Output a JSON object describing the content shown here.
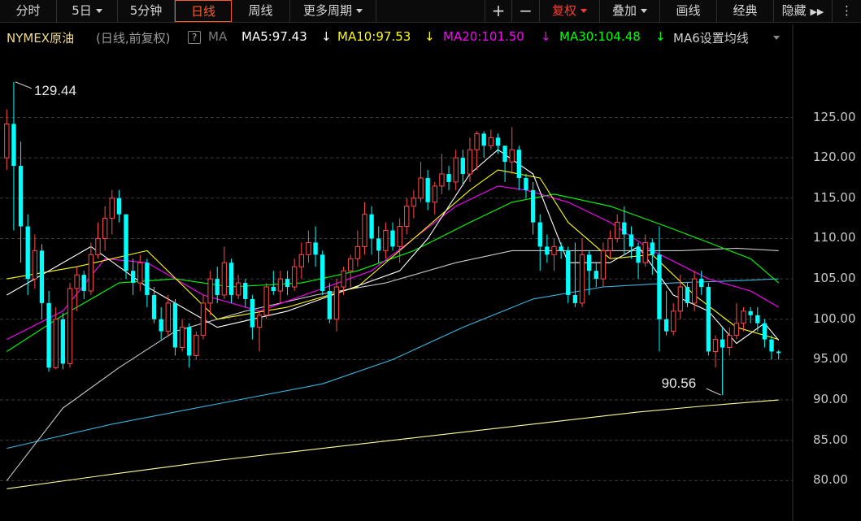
{
  "toolbar": {
    "tabs": [
      {
        "label": "分时"
      },
      {
        "label": "5日",
        "dropdown": true
      },
      {
        "label": "5分钟"
      },
      {
        "label": "日线",
        "active": true
      },
      {
        "label": "周线"
      },
      {
        "label": "更多周期",
        "dropdown": true
      }
    ],
    "right": [
      {
        "label": "+"
      },
      {
        "label": "−"
      },
      {
        "label": "复权",
        "dropdown": true,
        "accent": true
      },
      {
        "label": "叠加",
        "dropdown": true
      },
      {
        "label": "画线"
      },
      {
        "label": "经典"
      },
      {
        "label": "隐藏"
      }
    ],
    "expand_icon": "double-chevron-right-icon"
  },
  "legend": {
    "symbol": "NYMEX原油",
    "mode": "(日线,前复权)",
    "help": "?",
    "ma_label": "MA",
    "ma5": "MA5:97.43",
    "ma10": "MA10:97.53",
    "ma20": "MA20:101.50",
    "ma30": "MA30:104.48",
    "ma6": "MA6设置均线",
    "colors": {
      "ma5": "#ffffff",
      "ma10": "#ffff00",
      "ma20": "#ff00ff",
      "ma30": "#00ff00"
    }
  },
  "annotations": {
    "high": "129.44",
    "low": "90.56"
  },
  "colors": {
    "up": "#ff4a4a",
    "down": "#00ffff",
    "ma5": "#ffffff",
    "ma10": "#ffff00",
    "ma20": "#ff00ff",
    "ma30": "#00ff00",
    "ma60": "#c8c8c8",
    "ma120": "#3ab4e0",
    "ma250": "#ffff99",
    "grid": "#3a3a3a"
  },
  "chart_data": {
    "type": "candlestick",
    "ylim": [
      75,
      132
    ],
    "yticks": [
      "125.00",
      "120.00",
      "115.00",
      "110.00",
      "105.00",
      "100.00",
      "95.00",
      "90.00",
      "85.00",
      "80.00"
    ],
    "grid": true,
    "candles": [
      [
        120.0,
        124.2,
        126.0,
        118.5
      ],
      [
        124.2,
        119.0,
        129.4,
        111.0
      ],
      [
        119.0,
        111.5,
        122.0,
        107.0
      ],
      [
        111.5,
        105.0,
        113.0,
        103.0
      ],
      [
        105.0,
        108.5,
        110.5,
        103.8
      ],
      [
        108.5,
        102.0,
        109.3,
        100.0
      ],
      [
        102.0,
        94.0,
        103.5,
        93.5
      ],
      [
        94.0,
        100.0,
        101.5,
        93.8
      ],
      [
        100.0,
        94.5,
        100.8,
        93.8
      ],
      [
        94.5,
        103.8,
        104.5,
        94.0
      ],
      [
        103.8,
        105.5,
        106.5,
        101.0
      ],
      [
        105.5,
        103.5,
        106.0,
        102.5
      ],
      [
        103.5,
        108.0,
        109.5,
        103.0
      ],
      [
        108.0,
        110.0,
        112.0,
        107.5
      ],
      [
        110.0,
        112.5,
        114.0,
        108.5
      ],
      [
        112.5,
        115.0,
        116.0,
        110.5
      ],
      [
        115.0,
        113.0,
        116.0,
        112.0
      ],
      [
        113.0,
        106.0,
        113.0,
        105.0
      ],
      [
        106.0,
        104.5,
        107.5,
        103.0
      ],
      [
        104.5,
        107.0,
        108.0,
        103.5
      ],
      [
        107.0,
        103.0,
        107.5,
        101.5
      ],
      [
        103.0,
        100.0,
        104.0,
        99.5
      ],
      [
        100.0,
        98.5,
        101.5,
        97.5
      ],
      [
        98.5,
        102.0,
        103.0,
        98.0
      ],
      [
        102.0,
        96.5,
        102.5,
        95.5
      ],
      [
        96.5,
        99.0,
        100.0,
        96.0
      ],
      [
        99.0,
        95.5,
        99.5,
        94.0
      ],
      [
        95.5,
        98.0,
        98.5,
        95.0
      ],
      [
        98.0,
        102.0,
        103.0,
        97.5
      ],
      [
        102.0,
        105.0,
        106.0,
        100.5
      ],
      [
        105.0,
        103.0,
        106.5,
        102.0
      ],
      [
        103.0,
        107.0,
        109.0,
        102.5
      ],
      [
        107.0,
        103.0,
        107.5,
        102.0
      ],
      [
        103.0,
        104.5,
        105.5,
        102.5
      ],
      [
        104.5,
        102.5,
        105.0,
        101.5
      ],
      [
        102.5,
        99.0,
        103.0,
        97.5
      ],
      [
        99.0,
        100.5,
        101.0,
        96.0
      ],
      [
        100.5,
        104.0,
        104.5,
        100.0
      ],
      [
        104.0,
        103.5,
        106.0,
        103.0
      ],
      [
        103.5,
        105.0,
        106.0,
        102.0
      ],
      [
        105.0,
        104.0,
        106.0,
        103.0
      ],
      [
        104.0,
        106.5,
        107.5,
        103.5
      ],
      [
        106.5,
        108.0,
        109.5,
        105.0
      ],
      [
        108.0,
        109.5,
        111.0,
        107.0
      ],
      [
        109.5,
        108.0,
        111.5,
        106.5
      ],
      [
        108.0,
        103.5,
        108.5,
        103.0
      ],
      [
        103.5,
        100.0,
        104.5,
        99.5
      ],
      [
        100.0,
        104.0,
        105.0,
        98.5
      ],
      [
        104.0,
        106.0,
        106.5,
        103.0
      ],
      [
        106.0,
        107.5,
        108.0,
        104.0
      ],
      [
        107.5,
        109.0,
        111.0,
        106.5
      ],
      [
        109.0,
        113.0,
        114.5,
        108.0
      ],
      [
        113.0,
        110.0,
        114.0,
        108.0
      ],
      [
        110.0,
        108.5,
        111.5,
        107.0
      ],
      [
        108.5,
        111.0,
        112.0,
        107.5
      ],
      [
        111.0,
        109.0,
        112.0,
        108.5
      ],
      [
        109.0,
        111.5,
        112.5,
        107.0
      ],
      [
        111.5,
        114.0,
        115.0,
        110.5
      ],
      [
        114.0,
        115.0,
        116.0,
        112.5
      ],
      [
        115.0,
        117.5,
        119.5,
        114.5
      ],
      [
        117.5,
        114.5,
        118.5,
        113.5
      ],
      [
        114.5,
        116.5,
        117.0,
        113.0
      ],
      [
        116.5,
        118.0,
        120.5,
        115.5
      ],
      [
        118.0,
        117.0,
        119.0,
        116.0
      ],
      [
        117.0,
        120.0,
        121.0,
        116.0
      ],
      [
        120.0,
        118.0,
        121.0,
        116.5
      ],
      [
        118.0,
        121.0,
        122.5,
        117.0
      ],
      [
        121.0,
        123.0,
        123.3,
        118.5
      ],
      [
        123.0,
        121.5,
        123.3,
        120.0
      ],
      [
        121.5,
        122.5,
        123.5,
        121.0
      ],
      [
        122.5,
        121.5,
        123.0,
        120.5
      ],
      [
        121.5,
        119.5,
        121.5,
        117.0
      ],
      [
        119.5,
        121.0,
        123.8,
        118.0
      ],
      [
        121.0,
        117.5,
        121.5,
        116.0
      ],
      [
        117.5,
        116.0,
        118.0,
        115.0
      ],
      [
        116.0,
        112.0,
        117.0,
        110.5
      ],
      [
        112.0,
        109.0,
        113.0,
        106.0
      ],
      [
        109.0,
        108.0,
        110.5,
        107.0
      ],
      [
        108.0,
        109.0,
        110.0,
        106.0
      ],
      [
        109.0,
        108.5,
        109.5,
        107.5
      ],
      [
        108.5,
        103.0,
        109.0,
        102.0
      ],
      [
        103.0,
        102.0,
        109.5,
        101.5
      ],
      [
        102.0,
        108.0,
        110.0,
        101.5
      ],
      [
        108.0,
        106.0,
        108.5,
        103.0
      ],
      [
        106.0,
        105.0,
        107.0,
        104.0
      ],
      [
        105.0,
        108.5,
        109.5,
        104.0
      ],
      [
        108.5,
        110.0,
        111.0,
        107.5
      ],
      [
        110.0,
        112.0,
        113.0,
        109.5
      ],
      [
        112.0,
        110.5,
        114.0,
        108.0
      ],
      [
        110.5,
        109.0,
        111.5,
        107.5
      ],
      [
        109.0,
        107.0,
        109.5,
        105.0
      ],
      [
        107.0,
        109.5,
        110.5,
        106.5
      ],
      [
        109.5,
        108.0,
        110.0,
        105.5
      ],
      [
        108.0,
        100.0,
        111.5,
        96.0
      ],
      [
        100.0,
        98.5,
        103.5,
        98.0
      ],
      [
        98.5,
        101.0,
        102.0,
        98.0
      ],
      [
        101.0,
        104.0,
        105.5,
        100.0
      ],
      [
        104.0,
        102.0,
        104.5,
        101.5
      ],
      [
        102.0,
        105.0,
        106.0,
        101.0
      ],
      [
        105.0,
        104.0,
        106.0,
        103.0
      ],
      [
        104.0,
        96.0,
        104.5,
        95.5
      ],
      [
        96.0,
        97.5,
        98.0,
        94.0
      ],
      [
        97.5,
        96.5,
        99.0,
        90.6
      ],
      [
        96.5,
        98.0,
        99.0,
        95.5
      ],
      [
        98.0,
        99.5,
        102.0,
        97.5
      ],
      [
        99.5,
        101.0,
        101.5,
        98.5
      ],
      [
        101.0,
        100.5,
        101.5,
        99.5
      ],
      [
        100.5,
        99.5,
        101.5,
        98.5
      ],
      [
        99.5,
        97.5,
        100.0,
        96.5
      ],
      [
        97.5,
        96.0,
        98.0,
        95.0
      ],
      [
        96.0,
        95.8,
        96.2,
        95.0
      ]
    ],
    "ma_lines": {
      "ma5": [
        [
          0,
          103.0
        ],
        [
          12,
          109.0
        ],
        [
          20,
          104.0
        ],
        [
          30,
          99.0
        ],
        [
          40,
          101.0
        ],
        [
          48,
          103.5
        ],
        [
          56,
          106.0
        ],
        [
          60,
          110.0
        ],
        [
          66,
          118.0
        ],
        [
          70,
          121.0
        ],
        [
          75,
          118.0
        ],
        [
          80,
          107.0
        ],
        [
          86,
          107.0
        ],
        [
          90,
          109.0
        ],
        [
          95,
          103.0
        ],
        [
          100,
          101.0
        ],
        [
          104,
          97.0
        ],
        [
          108,
          99.5
        ],
        [
          110,
          97.4
        ]
      ],
      "ma10": [
        [
          0,
          105.0
        ],
        [
          10,
          106.5
        ],
        [
          20,
          108.5
        ],
        [
          30,
          100.0
        ],
        [
          40,
          101.5
        ],
        [
          50,
          104.0
        ],
        [
          58,
          110.0
        ],
        [
          66,
          116.0
        ],
        [
          70,
          118.5
        ],
        [
          76,
          117.5
        ],
        [
          80,
          112.0
        ],
        [
          86,
          107.5
        ],
        [
          92,
          108.0
        ],
        [
          98,
          103.0
        ],
        [
          104,
          99.0
        ],
        [
          110,
          97.5
        ]
      ],
      "ma20": [
        [
          0,
          97.5
        ],
        [
          8,
          101.0
        ],
        [
          14,
          107.5
        ],
        [
          20,
          107.0
        ],
        [
          28,
          103.0
        ],
        [
          36,
          101.0
        ],
        [
          44,
          103.5
        ],
        [
          52,
          106.0
        ],
        [
          58,
          110.0
        ],
        [
          64,
          114.0
        ],
        [
          70,
          116.5
        ],
        [
          74,
          116.0
        ],
        [
          80,
          114.5
        ],
        [
          86,
          112.0
        ],
        [
          92,
          108.5
        ],
        [
          100,
          105.0
        ],
        [
          106,
          103.5
        ],
        [
          110,
          101.5
        ]
      ],
      "ma30": [
        [
          0,
          96.0
        ],
        [
          8,
          100.5
        ],
        [
          16,
          104.5
        ],
        [
          24,
          105.0
        ],
        [
          32,
          104.0
        ],
        [
          42,
          104.5
        ],
        [
          50,
          106.0
        ],
        [
          58,
          108.5
        ],
        [
          66,
          112.0
        ],
        [
          72,
          114.5
        ],
        [
          78,
          115.5
        ],
        [
          86,
          114.0
        ],
        [
          94,
          111.5
        ],
        [
          100,
          109.5
        ],
        [
          106,
          107.5
        ],
        [
          110,
          104.5
        ]
      ],
      "ma60": [
        [
          0,
          80.0
        ],
        [
          8,
          89.0
        ],
        [
          16,
          94.0
        ],
        [
          24,
          98.5
        ],
        [
          34,
          101.0
        ],
        [
          44,
          103.0
        ],
        [
          54,
          104.5
        ],
        [
          64,
          107.0
        ],
        [
          72,
          108.5
        ],
        [
          80,
          108.5
        ],
        [
          88,
          108.5
        ],
        [
          96,
          108.5
        ],
        [
          104,
          108.8
        ],
        [
          110,
          108.5
        ]
      ],
      "ma120": [
        [
          0,
          84.0
        ],
        [
          15,
          87.0
        ],
        [
          30,
          89.5
        ],
        [
          45,
          92.0
        ],
        [
          55,
          95.0
        ],
        [
          65,
          99.0
        ],
        [
          75,
          102.5
        ],
        [
          85,
          104.0
        ],
        [
          95,
          104.5
        ],
        [
          105,
          104.8
        ],
        [
          110,
          105.0
        ]
      ],
      "ma250": [
        [
          0,
          79.0
        ],
        [
          15,
          80.8
        ],
        [
          30,
          82.5
        ],
        [
          45,
          84.0
        ],
        [
          60,
          85.5
        ],
        [
          75,
          87.0
        ],
        [
          90,
          88.5
        ],
        [
          100,
          89.3
        ],
        [
          110,
          90.0
        ]
      ]
    }
  }
}
